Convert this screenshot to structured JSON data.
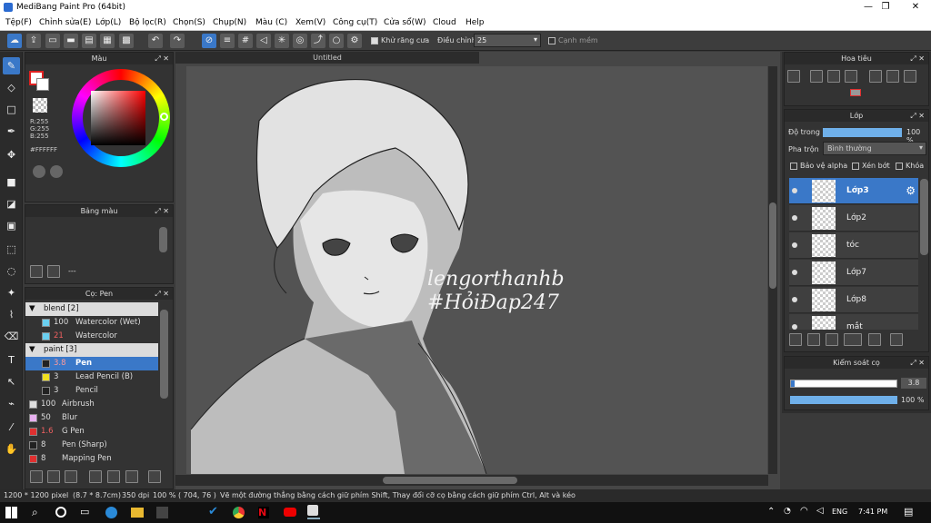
{
  "window": {
    "title": "MediBang Paint Pro (64bit)",
    "minimize": "—",
    "maximize": "❐",
    "close": "✕"
  },
  "menu": [
    "Tệp(F)",
    "Chỉnh sửa(E)",
    "Lớp(L)",
    "Bộ lọc(R)",
    "Chọn(S)",
    "Chụp(N)",
    "Màu (C)",
    "Xem(V)",
    "Công cụ(T)",
    "Cửa sổ(W)",
    "Cloud",
    "Help"
  ],
  "toolbar": {
    "antialias_label": "Khử răng cưa",
    "correction_label": "Điều chỉnh",
    "correction_value": "25",
    "edge_label": "Cạnh mềm"
  },
  "color_panel": {
    "title": "Màu",
    "r": "R:255",
    "g": "G:255",
    "b": "B:255",
    "hex": "#FFFFFF"
  },
  "palette_panel": {
    "title": "Bảng màu",
    "dash": "---"
  },
  "brush_panel": {
    "title": "Cọ: Pen",
    "groups": [
      {
        "name": "blend [2]",
        "items": [
          {
            "size": "100",
            "name": "Watercolor (Wet)",
            "color": "#6ad0f0"
          },
          {
            "size": "21",
            "name": "Watercolor",
            "color": "#6ad0f0"
          }
        ]
      },
      {
        "name": "paint [3]",
        "items": [
          {
            "size": "3.8",
            "name": "Pen",
            "color": "#222222",
            "selected": true
          },
          {
            "size": "3",
            "name": "Lead Pencil (B)",
            "color": "#f0e020"
          },
          {
            "size": "3",
            "name": "Pencil",
            "color": "#222222"
          }
        ]
      }
    ],
    "loose": [
      {
        "size": "100",
        "name": "Airbrush",
        "color": "#dddddd"
      },
      {
        "size": "50",
        "name": "Blur",
        "color": "#e8b0f0"
      },
      {
        "size": "1.6",
        "name": "G Pen",
        "color": "#e03030"
      },
      {
        "size": "8",
        "name": "Pen (Sharp)",
        "color": "#222222"
      },
      {
        "size": "8",
        "name": "Mapping Pen",
        "color": "#e03030"
      }
    ]
  },
  "canvas": {
    "tab_title": "Untitled",
    "sig_line1": "lengorthanhb",
    "sig_line2": "#HỏiĐap247"
  },
  "navigator": {
    "title": "Hoa tiêu"
  },
  "layer_panel": {
    "title": "Lớp",
    "opacity_label": "Độ trong",
    "opacity_value": "100 %",
    "opacity": 1.0,
    "blend_label": "Pha trộn",
    "blend_value": "Bình thường",
    "protect_alpha": "Bảo vệ alpha",
    "clipping": "Xén bớt",
    "lock": "Khóa",
    "layers": [
      "Lớp3",
      "Lớp2",
      "tóc",
      "Lớp7",
      "Lớp8",
      "mắt"
    ]
  },
  "brush_control": {
    "title": "Kiểm soát cọ",
    "size_value": "3.8",
    "opacity_value": "100 %",
    "opacity": 1.0
  },
  "status": {
    "size": "1200 * 1200 pixel",
    "cm": "(8.7 * 8.7cm)",
    "dpi": "350 dpi",
    "zoom": "100 %",
    "coords": "( 704, 76 )",
    "hint": "Vẽ một đường thẳng bằng cách giữ phím Shift, Thay đổi cỡ cọ bằng cách giữ phím Ctrl, Alt và kéo"
  },
  "taskbar": {
    "lang": "ENG",
    "time": "7:41 PM"
  },
  "colors": {
    "accent": "#3a78c8",
    "panel": "#333333"
  }
}
